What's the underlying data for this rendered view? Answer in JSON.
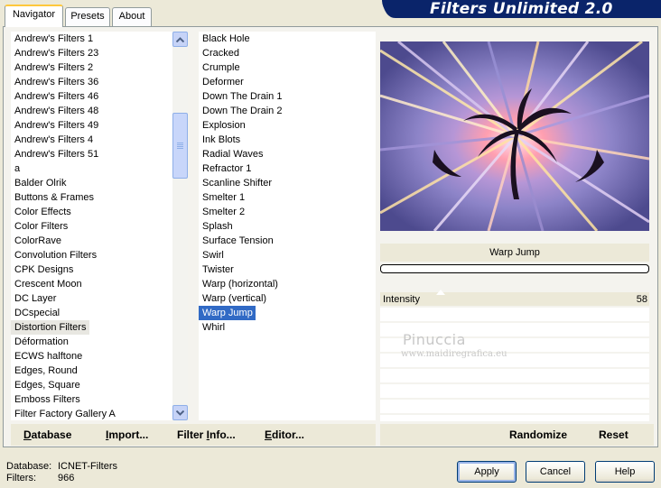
{
  "banner": {
    "title": "Filters Unlimited 2.0"
  },
  "tabs": [
    {
      "label": "Navigator",
      "active": true
    },
    {
      "label": "Presets",
      "active": false
    },
    {
      "label": "About",
      "active": false
    }
  ],
  "categories": {
    "items": [
      "Andrew's Filters 1",
      "Andrew's Filters 23",
      "Andrew's Filters 2",
      "Andrew's Filters 36",
      "Andrew's Filters 46",
      "Andrew's Filters 48",
      "Andrew's Filters 49",
      "Andrew's Filters 4",
      "Andrew's Filters 51",
      "a",
      "Balder Olrik",
      "Buttons & Frames",
      "Color Effects",
      "Color Filters",
      "ColorRave",
      "Convolution Filters",
      "CPK Designs",
      "Crescent Moon",
      "DC Layer",
      "DCspecial",
      "Distortion Filters",
      "Déformation",
      "ECWS halftone",
      "Edges, Round",
      "Edges, Square",
      "Emboss Filters",
      "Filter Factory Gallery A"
    ],
    "highlighted": "Distortion Filters"
  },
  "filters": {
    "items": [
      "Black Hole",
      "Cracked",
      "Crumple",
      "Deformer",
      "Down The Drain 1",
      "Down The Drain 2",
      "Explosion",
      "Ink Blots",
      "Radial Waves",
      "Refractor 1",
      "Scanline Shifter",
      "Smelter 1",
      "Smelter 2",
      "Splash",
      "Surface Tension",
      "Swirl",
      "Twister",
      "Warp (horizontal)",
      "Warp (vertical)",
      "Warp Jump",
      "Whirl"
    ],
    "selected": "Warp Jump"
  },
  "scrollbar": {
    "up_icon": "arrow-up-icon",
    "down_icon": "arrow-down-icon"
  },
  "filter_panel": {
    "title": "Warp Jump",
    "progress": 0,
    "controls": [
      {
        "label": "Intensity",
        "value": "58"
      }
    ]
  },
  "watermark": {
    "line1": "Pinuccia",
    "line2": "www.maidiregrafica.eu"
  },
  "toolbar": {
    "database": {
      "u": "D",
      "rest": "atabase"
    },
    "import": {
      "u": "I",
      "rest": "mport..."
    },
    "filter_info": {
      "pre": "Filter ",
      "u": "I",
      "rest": "nfo..."
    },
    "editor": {
      "u": "E",
      "rest": "ditor..."
    },
    "randomize": "Randomize",
    "reset": "Reset"
  },
  "status": {
    "database_label": "Database:",
    "database_value": "ICNET-Filters",
    "filters_label": "Filters:",
    "filters_value": "966"
  },
  "buttons": {
    "apply": "Apply",
    "cancel": "Cancel",
    "help": "Help"
  },
  "colors": {
    "banner": "#0a246a",
    "selection": "#316ac5",
    "face": "#ece9d8"
  }
}
